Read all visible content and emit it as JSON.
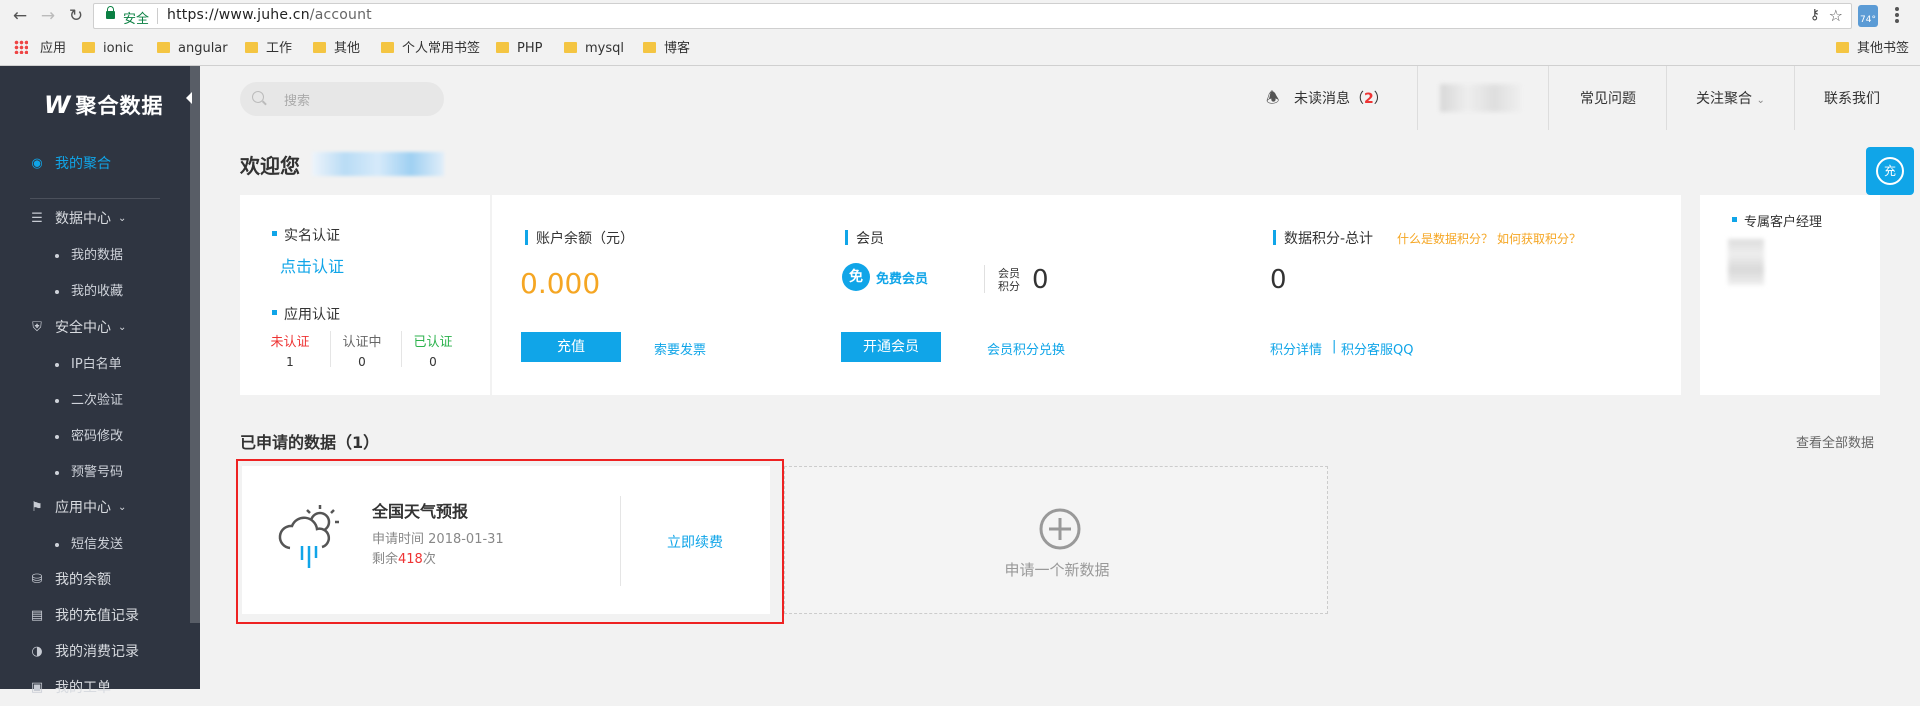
{
  "browser": {
    "secure_label": "安全",
    "url_host": "https://www.juhe.cn",
    "url_path": "/account",
    "ext_badge": "74°",
    "bookmarks": [
      "应用",
      "ionic",
      "angular",
      "工作",
      "其他",
      "个人常用书签",
      "PHP",
      "mysql",
      "博客"
    ],
    "other_bookmarks": "其他书签"
  },
  "sidebar": {
    "logo": "聚合数据",
    "items": {
      "my_juhe": "我的聚合",
      "data_center": "数据中心",
      "my_data": "我的数据",
      "my_favorites": "我的收藏",
      "security_center": "安全中心",
      "ip_whitelist": "IP白名单",
      "two_factor": "二次验证",
      "change_password": "密码修改",
      "alert_number": "预警号码",
      "app_center": "应用中心",
      "sms_send": "短信发送",
      "my_balance": "我的余额",
      "recharge_records": "我的充值记录",
      "consumption_records": "我的消费记录",
      "my_tickets": "我的工单"
    }
  },
  "header": {
    "search_placeholder": "搜索",
    "unread_label": "未读消息",
    "unread_count": "2",
    "faq": "常见问题",
    "follow": "关注聚合",
    "contact": "联系我们"
  },
  "welcome": "欢迎您",
  "auth": {
    "realname_title": "实名认证",
    "realname_link": "点击认证",
    "app_title": "应用认证",
    "statuses": [
      {
        "label": "未认证",
        "count": "1",
        "color": "#e33"
      },
      {
        "label": "认证中",
        "count": "0",
        "color": "#666"
      },
      {
        "label": "已认证",
        "count": "0",
        "color": "#2bb24c"
      }
    ]
  },
  "account": {
    "balance_title": "账户余额（元）",
    "balance": "0.000",
    "recharge_btn": "充值",
    "invoice_link": "索要发票",
    "member_title": "会员",
    "member_badge": "免",
    "member_type": "免费会员",
    "member_points_label_1": "会员",
    "member_points_label_2": "积分",
    "member_points": "0",
    "open_member_btn": "开通会员",
    "points_exchange": "会员积分兑换",
    "data_points_title": "数据积分-总计",
    "what_is_points": "什么是数据积分？",
    "how_to_get": "如何获取积分？",
    "data_points": "0",
    "points_detail": "积分详情",
    "points_qq": "积分客服QQ"
  },
  "manager": {
    "title": "专属客户经理"
  },
  "applied": {
    "title": "已申请的数据",
    "count": "1",
    "view_all": "查看全部数据",
    "cards": [
      {
        "name": "全国天气预报",
        "apply_label": "申请时间",
        "apply_date": "2018-01-31",
        "remain_prefix": "剩余",
        "remain_count": "418",
        "remain_suffix": "次",
        "renew": "立即续费"
      }
    ],
    "new_label": "申请一个新数据"
  },
  "badge_text": "充"
}
